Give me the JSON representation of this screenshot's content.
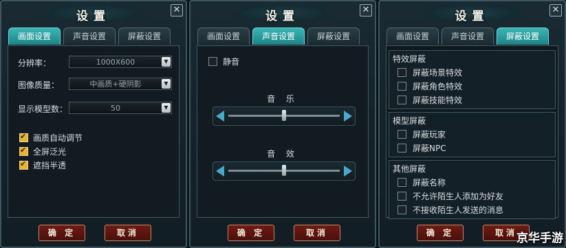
{
  "window_title": "设置",
  "tabs": [
    "画面设置",
    "声音设置",
    "屏蔽设置"
  ],
  "display": {
    "resolution_label": "分辨率：",
    "resolution_value": "1000X600",
    "quality_label": "图像质量：",
    "quality_value": "中画质+硬阴影",
    "model_count_label": "显示模型数：",
    "model_count_value": "50",
    "checkboxes": [
      {
        "label": "画质自动调节",
        "checked": true
      },
      {
        "label": "全屏泛光",
        "checked": true
      },
      {
        "label": "遮挡半透",
        "checked": true
      }
    ]
  },
  "sound": {
    "mute_label": "静音",
    "mute_checked": false,
    "music_label": "音 乐",
    "music_level": 0.5,
    "effects_label": "音 效",
    "effects_level": 0.5
  },
  "block": {
    "groups": [
      {
        "title": "特效屏蔽",
        "items": [
          "屏蔽场景特效",
          "屏蔽角色特效",
          "屏蔽技能特效"
        ]
      },
      {
        "title": "模型屏蔽",
        "items": [
          "屏蔽玩家",
          "屏蔽NPC"
        ]
      },
      {
        "title": "其他屏蔽",
        "items": [
          "屏蔽名称",
          "不允许陌生人添加为好友",
          "不接收陌生人发送的消息"
        ]
      }
    ]
  },
  "buttons": {
    "ok": "确 定",
    "cancel": "取消"
  },
  "close_glyph": "✕",
  "watermark": "京华手游",
  "colors": {
    "active_tab": "#2aa6a8",
    "button": "#5c150f",
    "checkbox_checked": "#e6b33a"
  }
}
